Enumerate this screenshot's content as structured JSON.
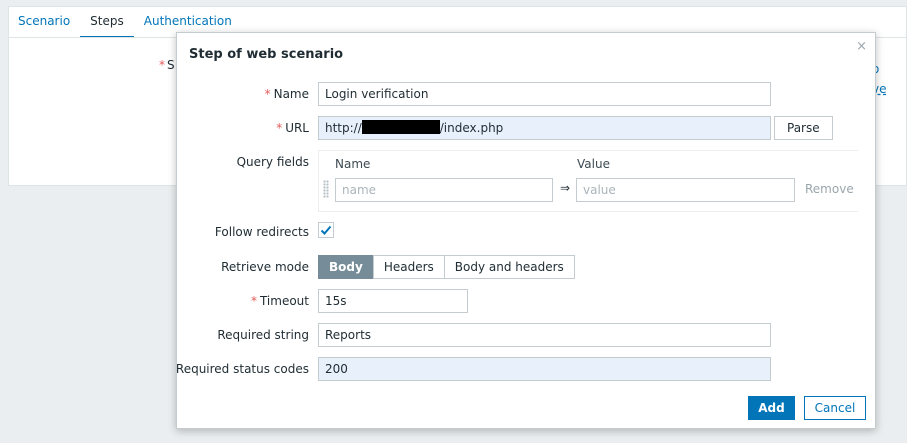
{
  "tabs": [
    {
      "label": "Scenario"
    },
    {
      "label": "Steps"
    },
    {
      "label": "Authentication"
    }
  ],
  "background": {
    "field_label_initial": "S",
    "frag_right_1": "o",
    "frag_right_2": "ve"
  },
  "dialog": {
    "title": "Step of web scenario",
    "close_glyph": "×",
    "name": {
      "label": "Name",
      "value": "Login verification"
    },
    "url": {
      "label": "URL",
      "value_prefix": "http://",
      "value_suffix": "/index.php",
      "parse_label": "Parse"
    },
    "query_fields": {
      "label": "Query fields",
      "col_name": "Name",
      "col_value": "Value",
      "name_placeholder": "name",
      "value_placeholder": "value",
      "arrow": "⇒",
      "remove_label": "Remove"
    },
    "follow_redirects": {
      "label": "Follow redirects",
      "checked": true
    },
    "retrieve_mode": {
      "label": "Retrieve mode",
      "options": [
        "Body",
        "Headers",
        "Body and headers"
      ],
      "selected": "Body"
    },
    "timeout": {
      "label": "Timeout",
      "value": "15s"
    },
    "required_string": {
      "label": "Required string",
      "value": "Reports"
    },
    "required_status_codes": {
      "label": "Required status codes",
      "value": "200"
    },
    "add_label": "Add",
    "cancel_label": "Cancel"
  },
  "colors": {
    "accent": "#0275b8",
    "required": "#e45959",
    "segment_active": "#768d99"
  }
}
